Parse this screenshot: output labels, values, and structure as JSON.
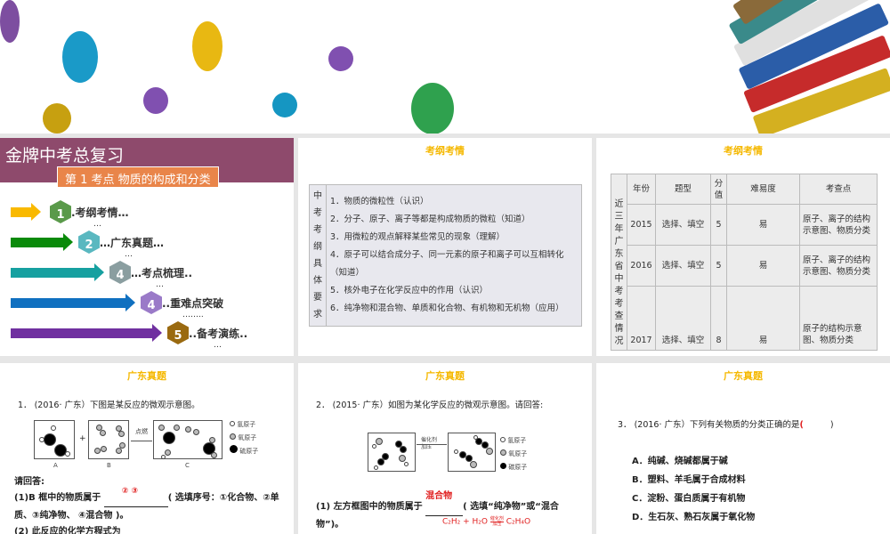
{
  "slide1": {
    "main_title": "金牌中考总复习",
    "subtitle": "第 1 考点  物质的构成和分类",
    "items": [
      {
        "num": "1",
        "label": ".考纲考情…"
      },
      {
        "num": "2",
        "label": "…广东真题…"
      },
      {
        "num": "4",
        "label": "…考点梳理.."
      },
      {
        "num": "4",
        "label": "..重难点突破"
      },
      {
        "num": "5",
        "label": "..备考演练.."
      }
    ],
    "dots": [
      "…",
      "…",
      "…",
      "……..",
      "…"
    ]
  },
  "slide2": {
    "title": "考纲考情",
    "side_label": "中考考纲具体要求",
    "lines": [
      "1．物质的微粒性（认识）",
      "2．分子、原子、离子等都是构成物质的微粒（知道）",
      "3．用微粒的观点解释某些常见的现象（理解）",
      "4．原子可以结合成分子、同一元素的原子和离子可以互相转化（知道）",
      "5．核外电子在化学反应中的作用（认识）",
      "6．纯净物和混合物、单质和化合物、有机物和无机物（应用）"
    ]
  },
  "slide3": {
    "title": "考纲考情",
    "side_label": "近三年广东省中考考查情况",
    "headers": [
      "年份",
      "题型",
      "分值",
      "难易度",
      "考查点"
    ],
    "rows": [
      [
        "2015",
        "选择、填空",
        "5",
        "易",
        "原子、离子的结构示意图、物质分类"
      ],
      [
        "2016",
        "选择、填空",
        "5",
        "易",
        "原子、离子的结构示意图、物质分类"
      ],
      [
        "2017",
        "选择、填空",
        "8",
        "易",
        "原子的结构示意图、物质分类"
      ]
    ]
  },
  "slide4": {
    "title": "广东真题",
    "question": "1． (2016· 广东）下图是某反应的微观示意图。",
    "box_labels": [
      "A",
      "B",
      "C"
    ],
    "plus": "+",
    "arrow_label": "点燃",
    "legend": [
      "氢原子",
      "氧原子",
      "硫原子"
    ],
    "prompt": "请回答:",
    "q1a": "(1)B 框中的物质属于",
    "answer": "② ③",
    "q1b": "( 选填序号：①化合物、②单质、③纯净物、 ④混合物 )。",
    "q2": "(2) 此反应的化学方程式为"
  },
  "slide5": {
    "title": "广东真题",
    "question": "2． (2015· 广东）如图为某化学反应的微观示意图。请回答:",
    "arrow_label_top": "催化剂",
    "arrow_label_bottom": "加压",
    "legend": [
      "氢原子",
      "氧原子",
      "碳原子"
    ],
    "q1a": "(1) 左方框图中的物质属于",
    "answer": "混合物",
    "q1b": "( 选填“纯净物”或“混合物”)。",
    "equation": {
      "left": "C₂H₂ + H₂O",
      "cond_top": "催化剂",
      "cond_bottom": "加压",
      "right": "C₂H₄O"
    }
  },
  "slide6": {
    "title": "广东真题",
    "question": "3． (2016· 广东）下列有关物质的分类正确的是",
    "answer_mark": "(",
    "paren_close": ")",
    "options": [
      "A．纯碱、烧碱都属于碱",
      "B．塑料、羊毛属于合成材料",
      "C．淀粉、蛋白质属于有机物",
      "D．生石灰、熟石灰属于氧化物"
    ]
  }
}
